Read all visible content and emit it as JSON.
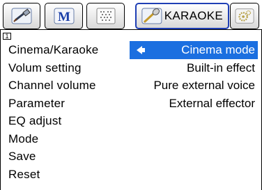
{
  "tabs": [
    {
      "icon": "hdmi-cable-icon",
      "label": ""
    },
    {
      "icon": "m-logo-icon",
      "label": ""
    },
    {
      "icon": "dotted-grid-icon",
      "label": ""
    },
    {
      "icon": "microphone-icon",
      "label": "KARAOKE",
      "active": true
    },
    {
      "icon": "gear-icon",
      "label": ""
    }
  ],
  "page_indicator": "1",
  "menu": {
    "items": [
      "Cinema/Karaoke",
      "Volum setting",
      "Channel volume",
      "Parameter",
      "EQ adjust",
      "Mode",
      "Save",
      "Reset"
    ]
  },
  "options": {
    "items": [
      "Cinema mode",
      "Built-in effect",
      "Pure external voice",
      "External effector"
    ],
    "selected_index": 0
  },
  "colors": {
    "highlight": "#1b6fe0",
    "active_tab_border": "#1f3fb5"
  }
}
